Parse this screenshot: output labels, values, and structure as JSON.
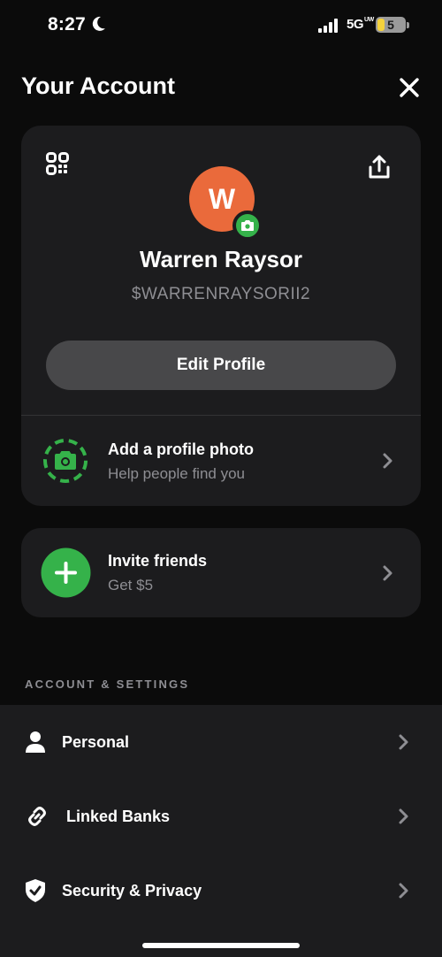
{
  "status": {
    "time": "8:27",
    "network": "5G",
    "network_super": "UW",
    "battery": "5"
  },
  "header": {
    "title": "Your Account"
  },
  "profile": {
    "avatar_initial": "W",
    "name": "Warren Raysor",
    "cashtag": "$WARRENRAYSORII2",
    "edit_button": "Edit Profile"
  },
  "photo_prompt": {
    "title": "Add a profile photo",
    "subtitle": "Help people find you"
  },
  "invite": {
    "title": "Invite friends",
    "subtitle": "Get $5"
  },
  "settings": {
    "section_label": "ACCOUNT & SETTINGS",
    "items": [
      {
        "label": "Personal",
        "icon": "person-icon"
      },
      {
        "label": "Linked Banks",
        "icon": "link-icon"
      },
      {
        "label": "Security & Privacy",
        "icon": "shield-check-icon"
      }
    ]
  },
  "colors": {
    "background": "#0b0b0b",
    "card": "#1c1c1e",
    "avatar": "#ea6a3b",
    "accent_green": "#35b24a",
    "muted_text": "#8e8e93"
  }
}
